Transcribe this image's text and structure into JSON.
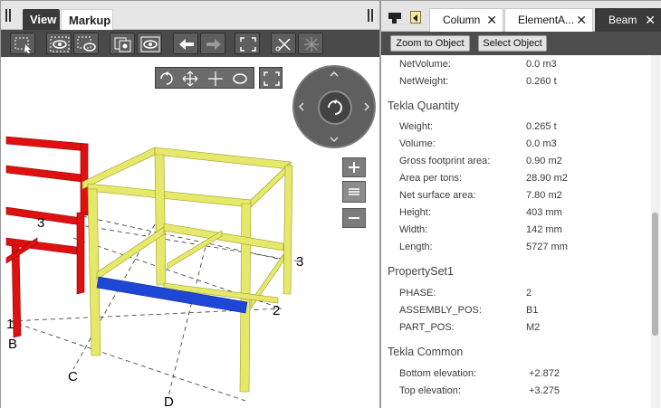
{
  "left_tabs": {
    "view": "View",
    "markup": "Markup"
  },
  "viewport": {
    "grid_labels": [
      "3",
      "3",
      "2",
      "1",
      "B",
      "C",
      "D"
    ]
  },
  "right_tabs": [
    {
      "label": "Column"
    },
    {
      "label": "ElementA..."
    },
    {
      "label": "Beam"
    }
  ],
  "right_toolbar": {
    "zoom_to_object": "Zoom to Object",
    "select_object": "Select Object"
  },
  "properties": {
    "top_rows": [
      {
        "key": "NetVolume:",
        "value": "0.0 m3"
      },
      {
        "key": "NetWeight:",
        "value": "0.260 t"
      }
    ],
    "sections": [
      {
        "title": "Tekla Quantity",
        "rows": [
          {
            "key": "Weight:",
            "value": "0.265 t"
          },
          {
            "key": "Volume:",
            "value": "0.0 m3"
          },
          {
            "key": "Gross footprint area:",
            "value": "0.90 m2"
          },
          {
            "key": "Area per tons:",
            "value": "28.90 m2"
          },
          {
            "key": "Net surface area:",
            "value": "7.80 m2"
          },
          {
            "key": "Height:",
            "value": "403 mm"
          },
          {
            "key": "Width:",
            "value": "142 mm"
          },
          {
            "key": "Length:",
            "value": "5727 mm"
          }
        ]
      },
      {
        "title": "PropertySet1",
        "rows": [
          {
            "key": "PHASE:",
            "value": "2"
          },
          {
            "key": "ASSEMBLY_POS:",
            "value": "B1"
          },
          {
            "key": "PART_POS:",
            "value": "M2"
          }
        ]
      },
      {
        "title": "Tekla Common",
        "rows": [
          {
            "key": "Bottom elevation:",
            "value": "+2.872"
          },
          {
            "key": "Top elevation:",
            "value": "+3.275"
          }
        ]
      }
    ]
  },
  "colors": {
    "selected_beam": "#1f47d6",
    "other_model": "#e01010",
    "highlight_frame": "#e6e86a",
    "toolbar": "#4a4a4a"
  }
}
